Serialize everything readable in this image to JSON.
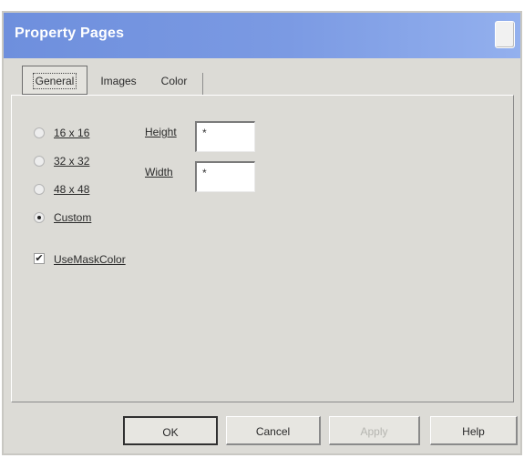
{
  "window": {
    "title": "Property Pages",
    "close_icon": "close-icon"
  },
  "tabs": [
    {
      "label": "General",
      "selected": true
    },
    {
      "label": "Images",
      "selected": false
    },
    {
      "label": "Color",
      "selected": false
    }
  ],
  "general": {
    "size_options": [
      {
        "label": "16 x 16",
        "checked": false
      },
      {
        "label": "32 x 32",
        "checked": false
      },
      {
        "label": "48 x 48",
        "checked": false
      },
      {
        "label": "Custom",
        "checked": true
      }
    ],
    "height_label": "Height",
    "height_value": "*",
    "width_label": "Width",
    "width_value": "*",
    "use_mask_color_label": "UseMaskColor",
    "use_mask_color_checked": true
  },
  "buttons": {
    "ok": "OK",
    "cancel": "Cancel",
    "apply": "Apply",
    "help": "Help"
  }
}
